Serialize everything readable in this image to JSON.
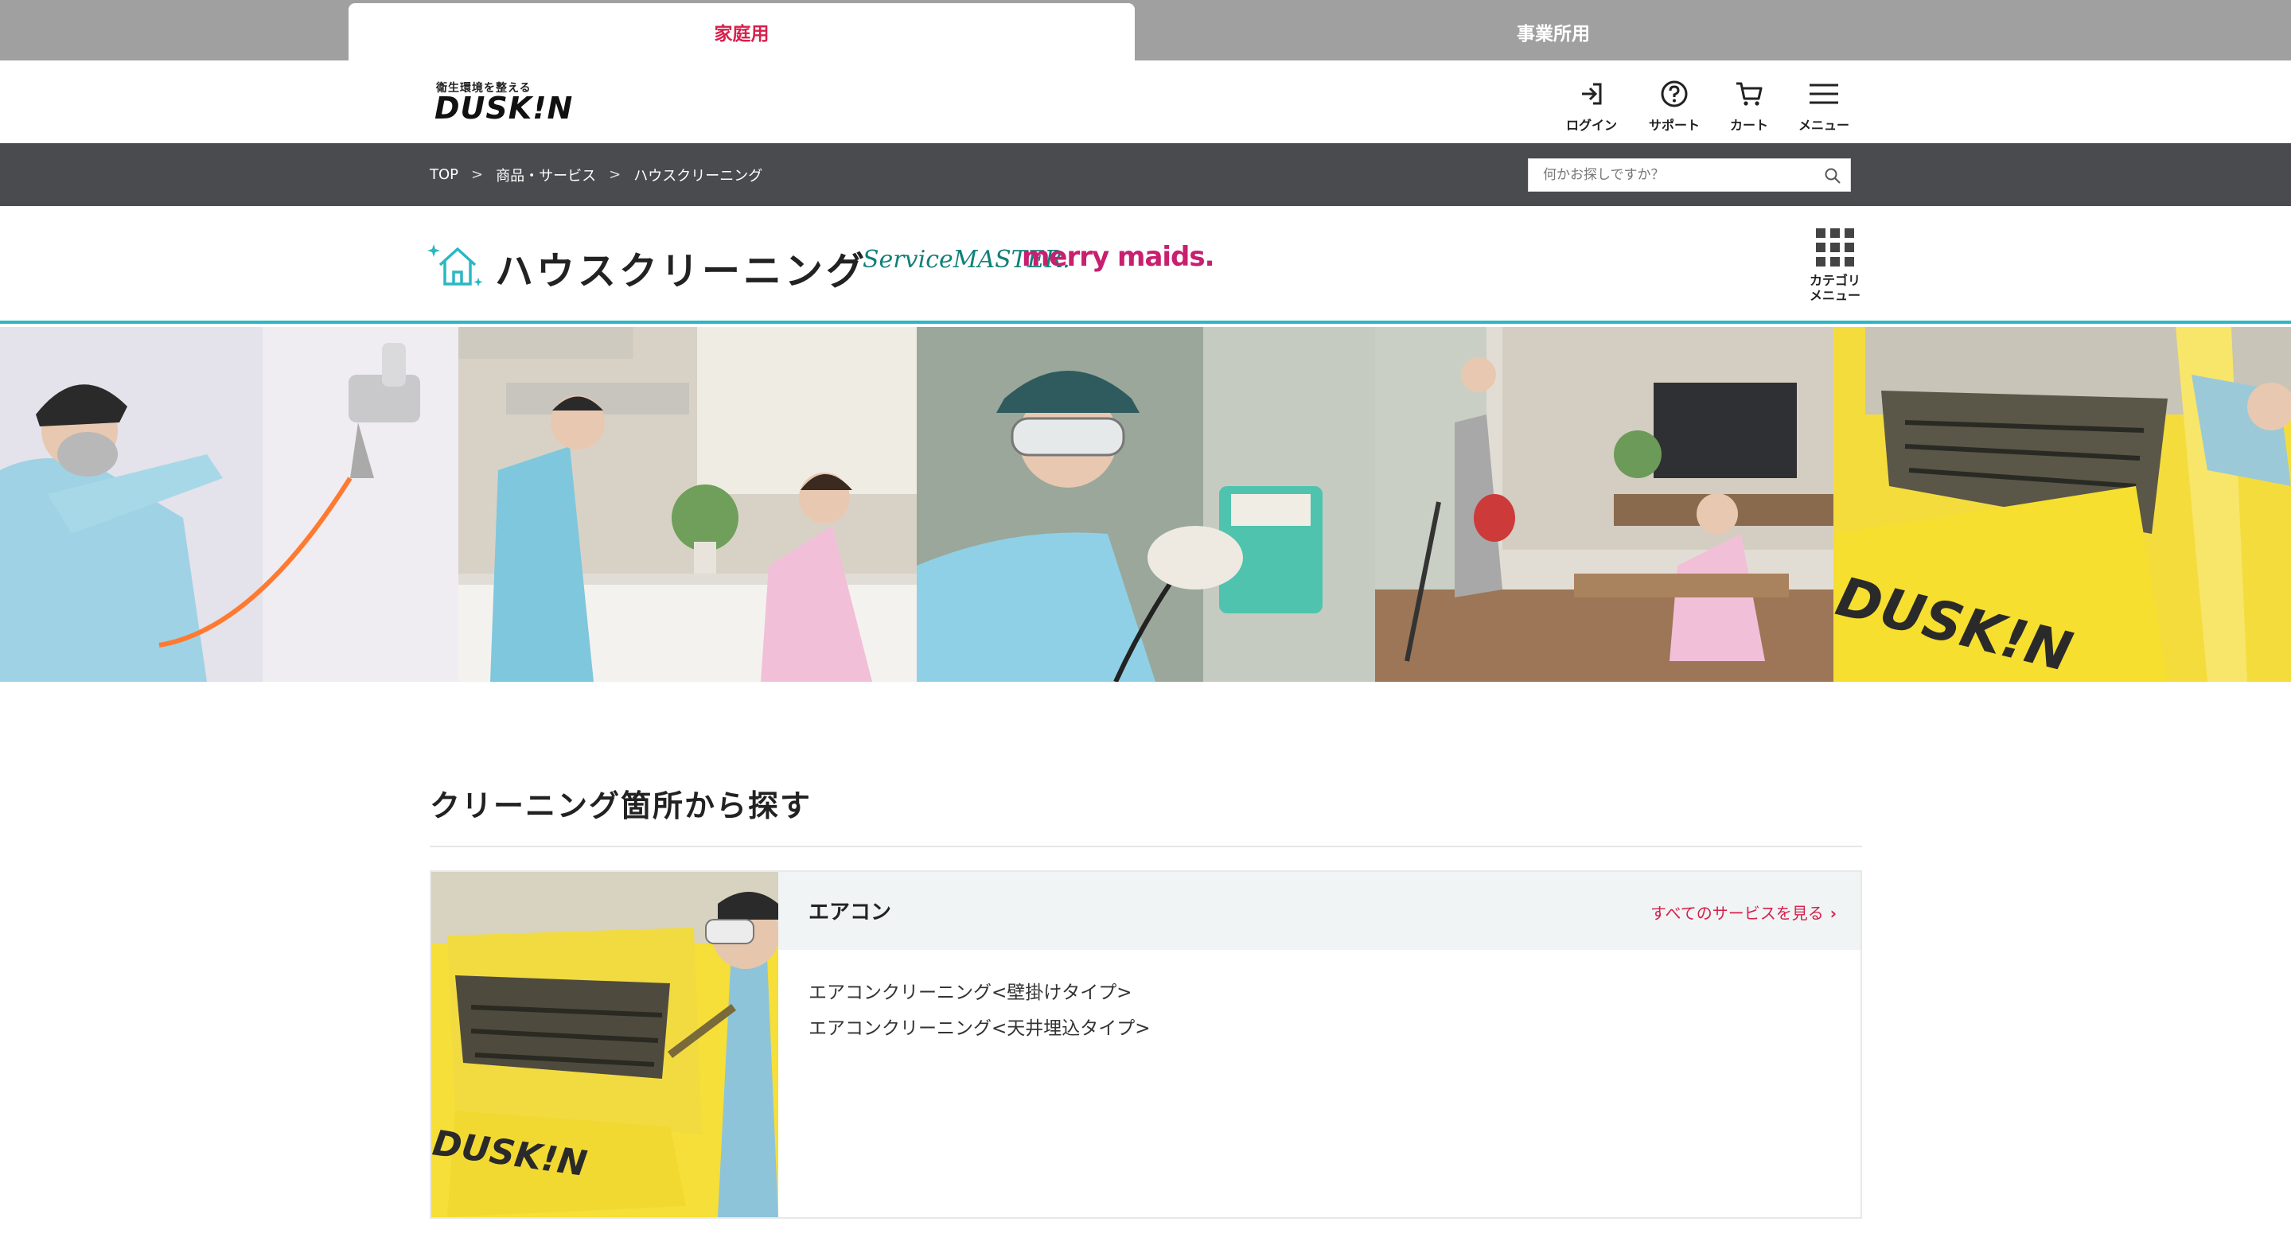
{
  "tabs": {
    "home": "家庭用",
    "business": "事業所用"
  },
  "logo": {
    "tagline": "衛生環境を整える",
    "wordmark": "DUSK!N"
  },
  "header_nav": [
    {
      "label": "ログイン",
      "icon": "login-icon"
    },
    {
      "label": "サポート",
      "icon": "help-circle-icon"
    },
    {
      "label": "カート",
      "icon": "cart-icon"
    },
    {
      "label": "メニュー",
      "icon": "hamburger-icon"
    }
  ],
  "breadcrumb": {
    "items": [
      "TOP",
      "商品・サービス",
      "ハウスクリーニング"
    ],
    "separator": ">"
  },
  "search": {
    "placeholder": "何かお探しですか？"
  },
  "category": {
    "title": "ハウスクリーニング",
    "brand_1": "ServiceMASTER.",
    "brand_2": "merry maids.",
    "menu_label": "カテゴリ\nメニュー"
  },
  "hero": {
    "logo_text": "DUSK!N"
  },
  "section": {
    "title": "クリーニング箇所から探す"
  },
  "card": {
    "title": "エアコン",
    "more_label": "すべてのサービスを見る",
    "chev": "›",
    "image_logo_text": "DUSK!N",
    "items": [
      "エアコンクリーニング<壁掛けタイプ>",
      "エアコンクリーニング<天井埋込タイプ>"
    ]
  },
  "colors": {
    "accent": "#d6204c",
    "teal": "#2bb7c3",
    "crumb_bar": "#4a4b4f",
    "tab_bar": "#a0a0a0",
    "service_master": "#11807a",
    "merry_maids": "#c81f70"
  }
}
